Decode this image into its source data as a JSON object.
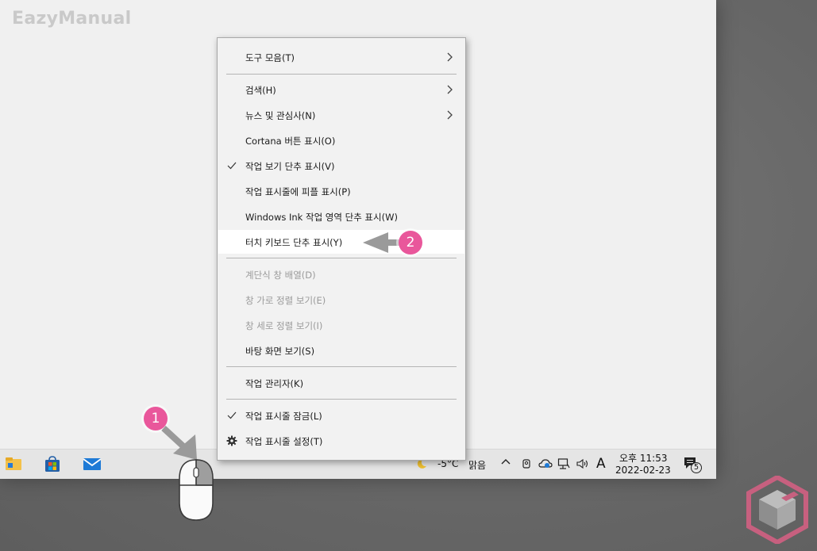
{
  "watermark": "EazyManual",
  "menu": {
    "items": [
      {
        "label": "도구 모음(T)",
        "submenu": true
      },
      {
        "label": "검색(H)",
        "submenu": true
      },
      {
        "label": "뉴스 및 관심사(N)",
        "submenu": true
      },
      {
        "label": "Cortana 버튼 표시(O)"
      },
      {
        "label": "작업 보기 단추 표시(V)",
        "checked": true
      },
      {
        "label": "작업 표시줄에 피플 표시(P)"
      },
      {
        "label": "Windows Ink 작업 영역 단추 표시(W)"
      },
      {
        "label": "터치 키보드 단추 표시(Y)",
        "highlighted": true
      },
      {
        "label": "계단식 창 배열(D)",
        "disabled": true
      },
      {
        "label": "창 가로 정렬 보기(E)",
        "disabled": true
      },
      {
        "label": "창 세로 정렬 보기(I)",
        "disabled": true
      },
      {
        "label": "바탕 화면 보기(S)"
      },
      {
        "label": "작업 관리자(K)"
      },
      {
        "label": "작업 표시줄 잠금(L)",
        "checked": true
      },
      {
        "label": "작업 표시줄 설정(T)",
        "icon": "gear-icon"
      }
    ]
  },
  "taskbar": {
    "apps": [
      "file-explorer-icon",
      "microsoft-store-icon",
      "mail-icon"
    ],
    "weather": {
      "temp": "-5°C",
      "condition": "맑음"
    },
    "ime": "A",
    "clock": {
      "time": "오후 11:53",
      "date": "2022-02-23"
    },
    "notifications": "5"
  },
  "callouts": {
    "step1": "1",
    "step2": "2"
  },
  "colors": {
    "badge": "#e9579b",
    "menu_bg": "#f2f2f2",
    "highlight_bg": "#ffffff",
    "desktop_bg": "#f0f0f0",
    "taskbar_bg": "#e5e5e5"
  }
}
